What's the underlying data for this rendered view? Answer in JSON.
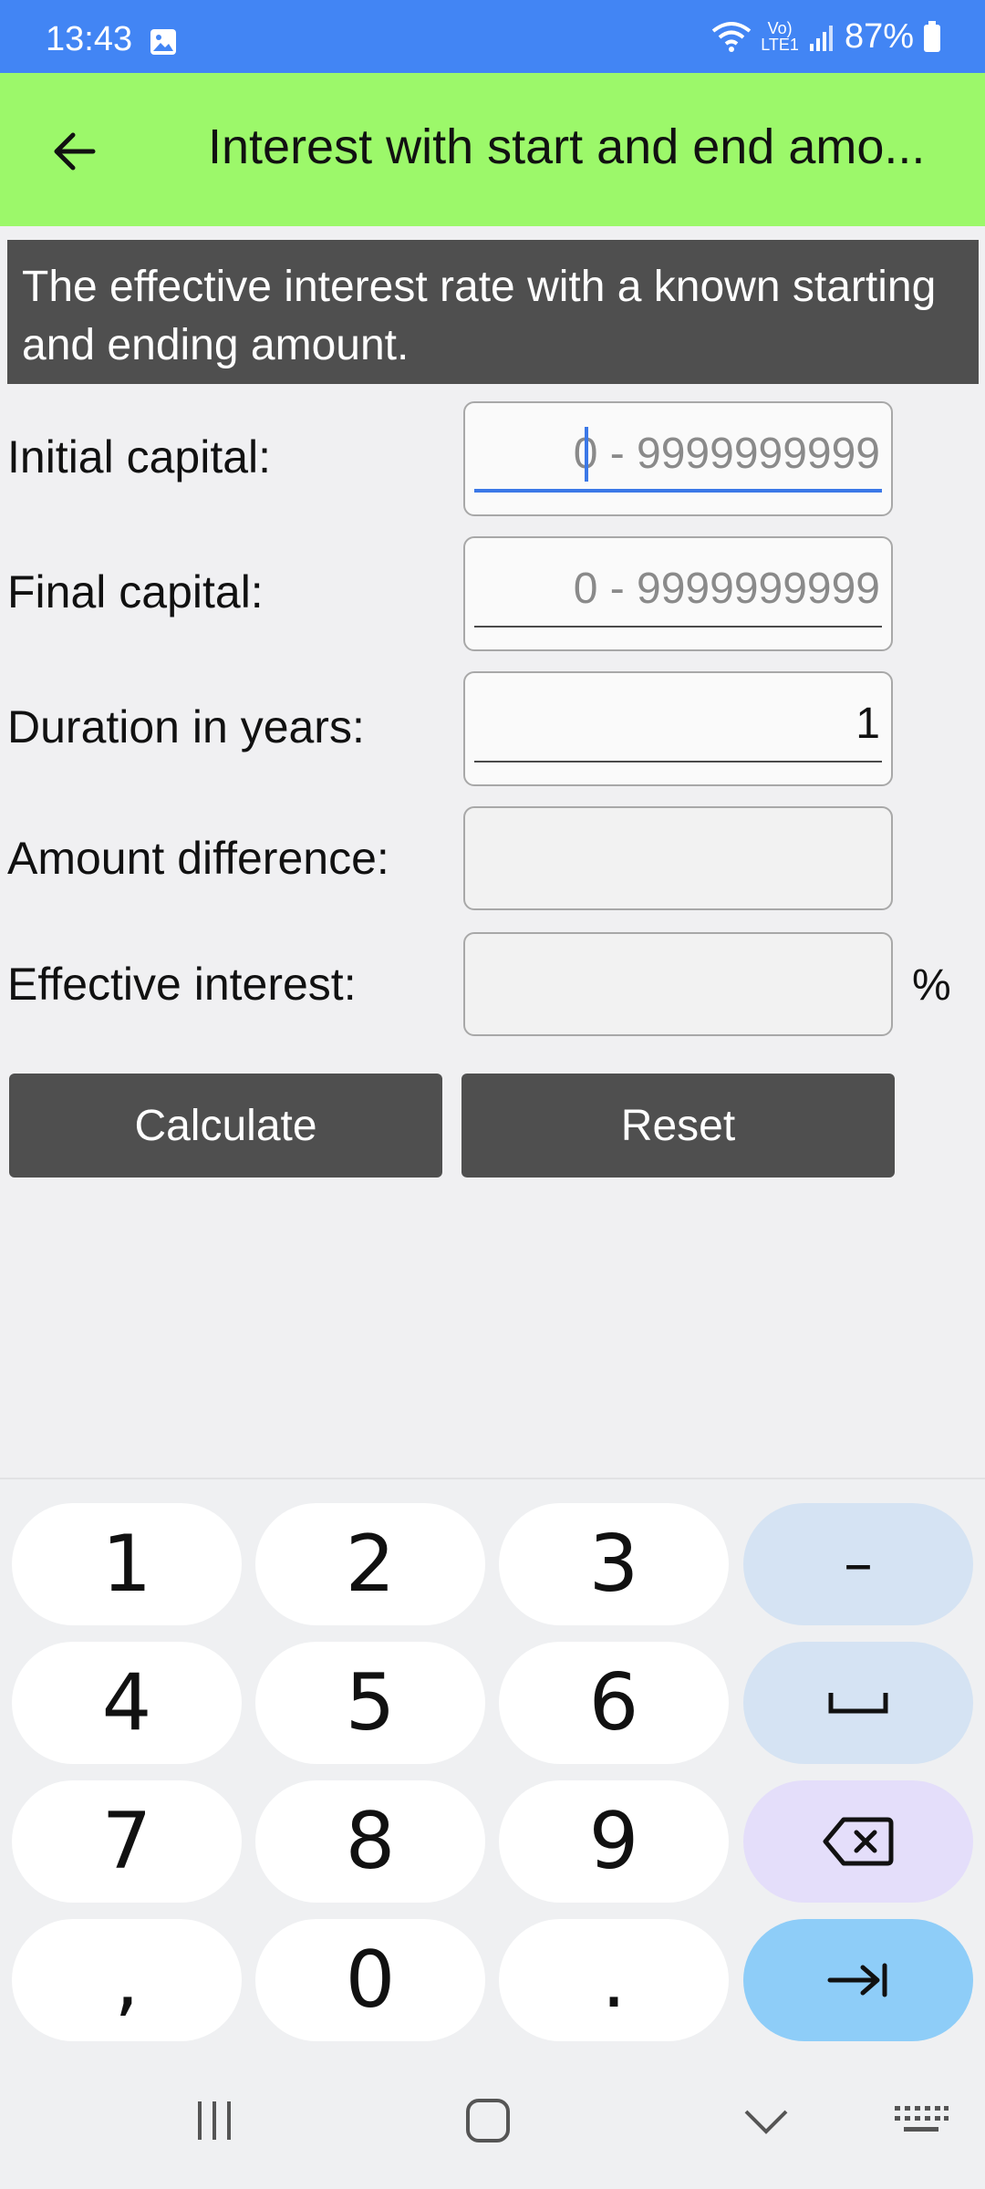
{
  "status_bar": {
    "time": "13:43",
    "network": "LTE1",
    "battery": "87%",
    "icons": [
      "image-icon",
      "wifi-icon",
      "signal-icon",
      "battery-icon"
    ]
  },
  "app_bar": {
    "title": "Interest with start and end amo...",
    "back_icon": "arrow-left-icon",
    "color": "#9cf86a"
  },
  "description": "The effective interest rate with a known starting and ending amount.",
  "form": {
    "initial_capital": {
      "label": "Initial capital:",
      "value": "",
      "placeholder": "0 - 9999999999"
    },
    "final_capital": {
      "label": "Final capital:",
      "value": "",
      "placeholder": "0 - 9999999999"
    },
    "duration": {
      "label": "Duration in years:",
      "value": "1"
    },
    "amount_difference": {
      "label": "Amount difference:",
      "value": ""
    },
    "effective_interest": {
      "label": "Effective interest:",
      "value": "",
      "unit": "%"
    }
  },
  "buttons": {
    "calculate": "Calculate",
    "reset": "Reset"
  },
  "keyboard": {
    "row1": [
      "1",
      "2",
      "3",
      "–"
    ],
    "row2": [
      "4",
      "5",
      "6"
    ],
    "row3": [
      "7",
      "8",
      "9"
    ],
    "row4": [
      ",",
      "0",
      "."
    ],
    "special_icons": [
      "space-icon",
      "backspace-icon",
      "tab-next-icon"
    ]
  },
  "navbar": {
    "icons": [
      "recents-icon",
      "home-icon",
      "hide-keyboard-icon",
      "keyboard-switch-icon"
    ]
  },
  "colors": {
    "status_bar": "#4285f4",
    "accent": "#3b78e7",
    "dark_panel": "#4f4f4f"
  }
}
